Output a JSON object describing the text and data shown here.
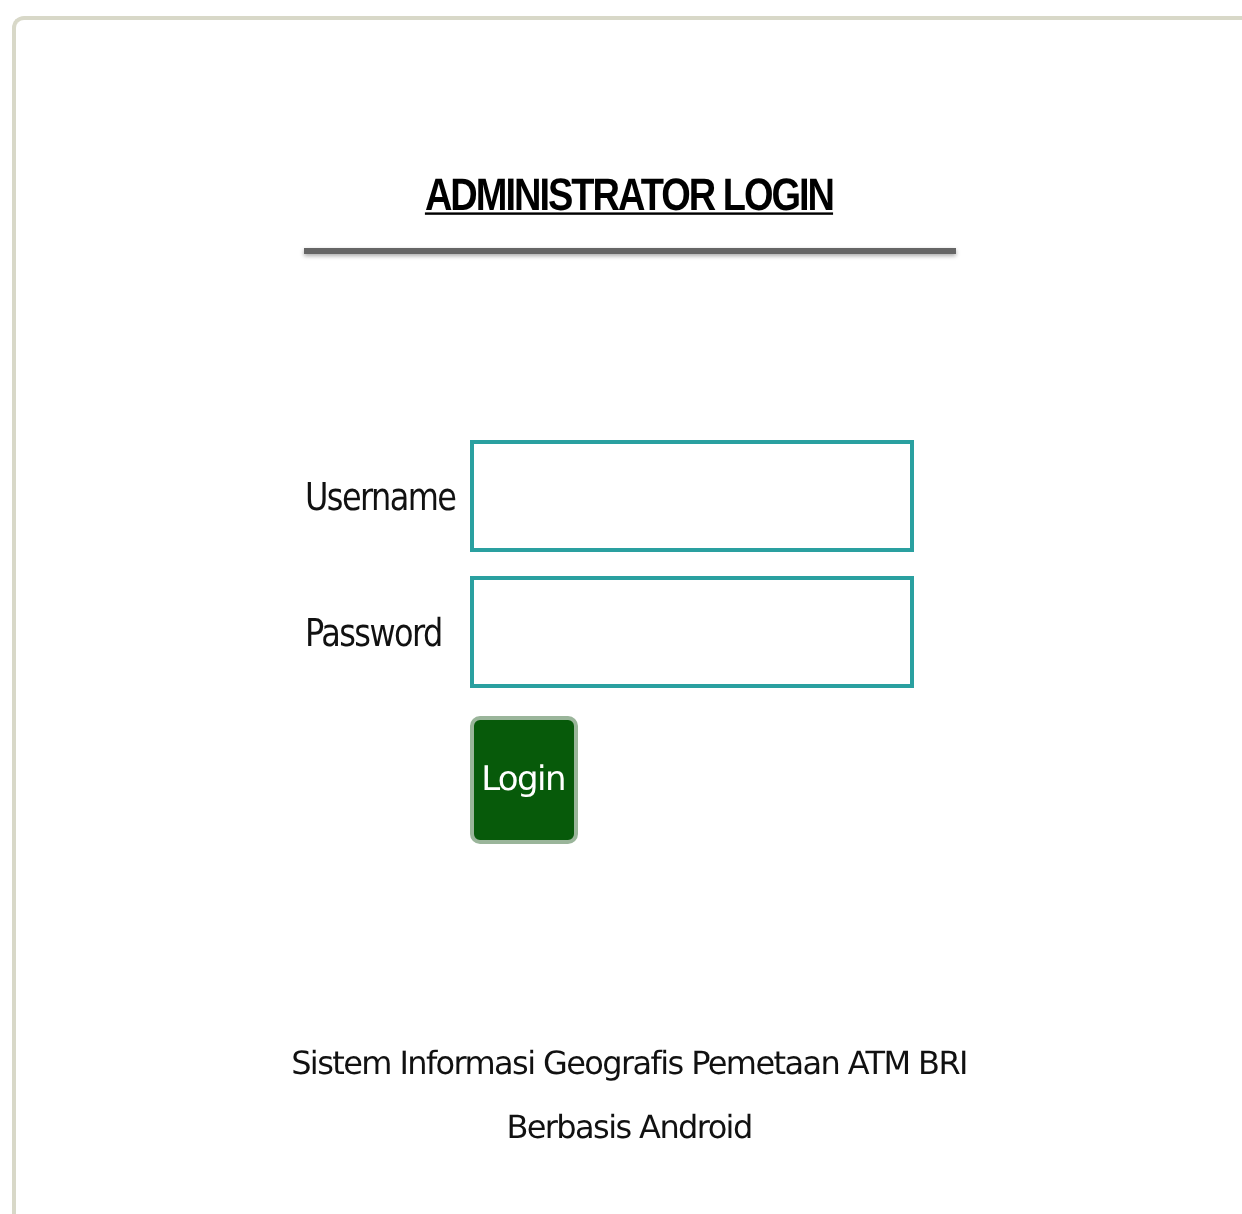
{
  "title": "ADMINISTRATOR LOGIN",
  "fields": [
    {
      "label": "Username"
    },
    {
      "label": "Password"
    }
  ],
  "button": "Login",
  "footer": [
    "Sistem Informasi Geografis Pemetaan ATM BRI",
    "Berbasis Android"
  ]
}
